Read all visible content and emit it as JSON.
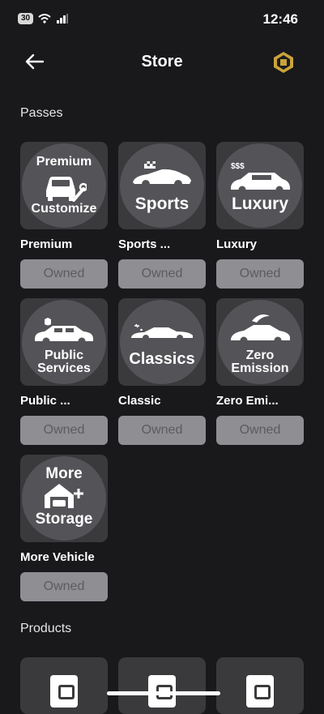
{
  "status_bar": {
    "battery": "30",
    "time": "12:46"
  },
  "header": {
    "title": "Store"
  },
  "sections": {
    "passes": "Passes",
    "products": "Products"
  },
  "passes": [
    {
      "lines": [
        "Premium",
        "Customize"
      ],
      "name": "Premium",
      "button": "Owned"
    },
    {
      "lines": [
        "Sports"
      ],
      "name": "Sports ...",
      "button": "Owned"
    },
    {
      "lines": [
        "Luxury"
      ],
      "name": "Luxury",
      "button": "Owned"
    },
    {
      "lines": [
        "Public",
        "Services"
      ],
      "name": "Public ...",
      "button": "Owned"
    },
    {
      "lines": [
        "Classics"
      ],
      "name": "Classic",
      "button": "Owned"
    },
    {
      "lines": [
        "Zero",
        "Emission"
      ],
      "name": "Zero Emi...",
      "button": "Owned"
    },
    {
      "lines": [
        "More",
        "Storage"
      ],
      "name": "More Vehicle",
      "button": "Owned"
    }
  ],
  "luxury_badge": "$$$",
  "icons": {
    "back": "arrow-left-icon",
    "currency": "robux-icon",
    "product": "wallet-icon"
  }
}
